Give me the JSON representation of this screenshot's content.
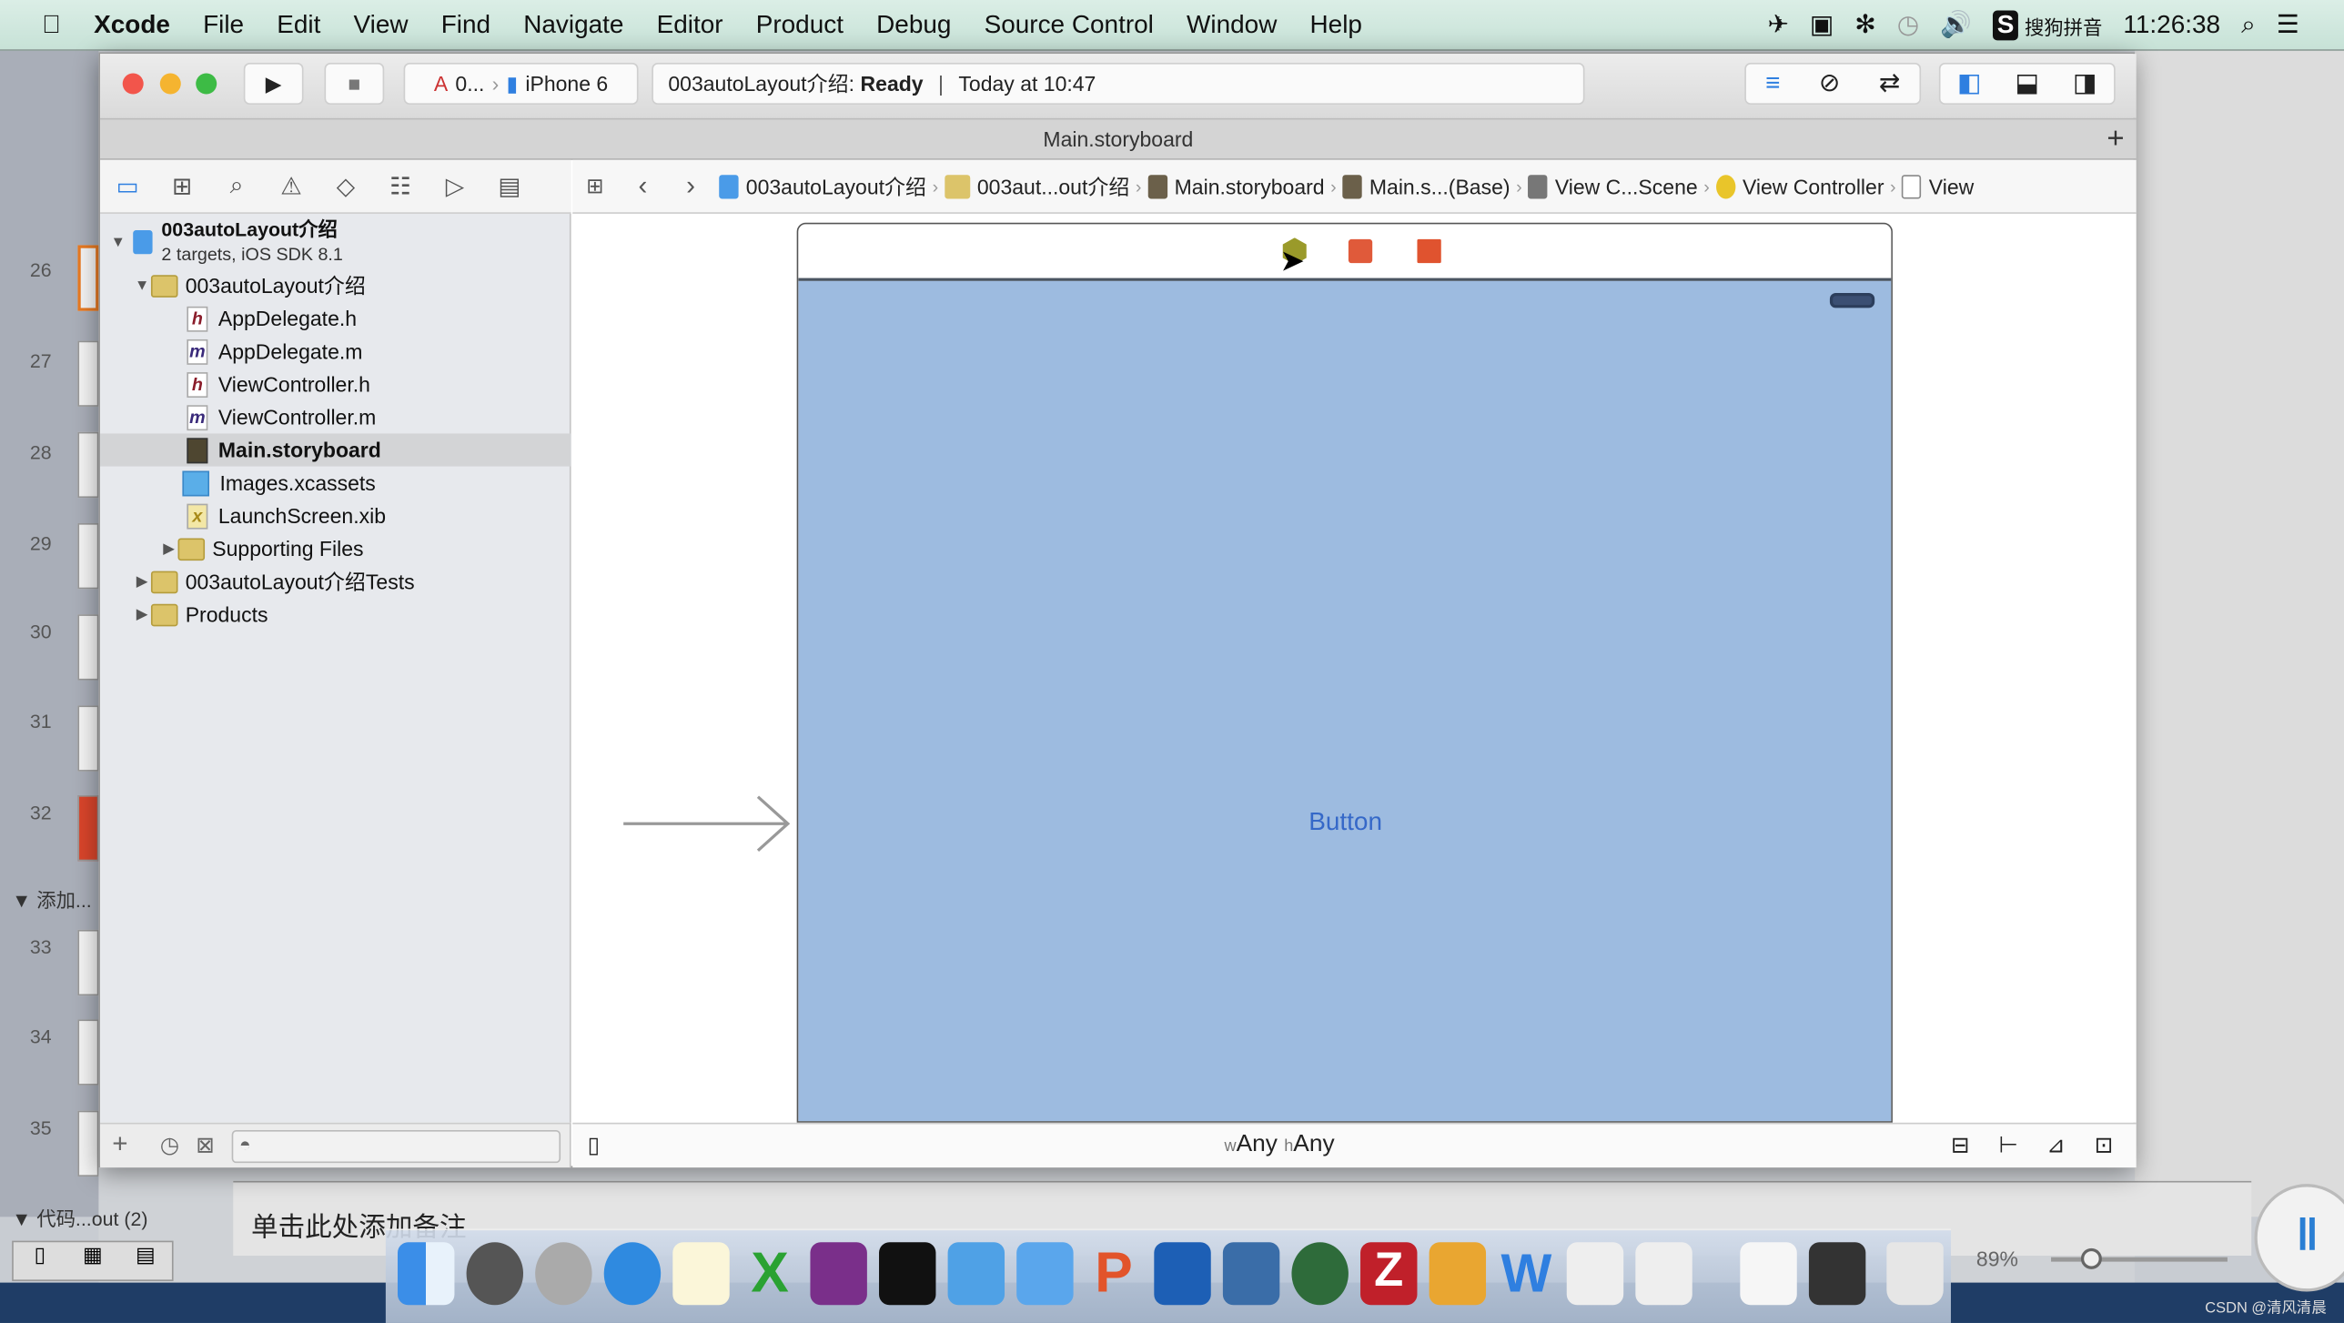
{
  "menubar": {
    "apple_icon": "apple-icon",
    "items": [
      "Xcode",
      "File",
      "Edit",
      "View",
      "Find",
      "Navigate",
      "Editor",
      "Product",
      "Debug",
      "Source Control",
      "Window",
      "Help"
    ],
    "input_method": "搜狗拼音",
    "clock": "11:26:38"
  },
  "toolbar": {
    "scheme": "0...",
    "device": "iPhone 6",
    "status_project": "003autoLayout介绍:",
    "status_state": "Ready",
    "status_time": "Today at 10:47"
  },
  "tab": {
    "title": "Main.storyboard"
  },
  "jumpbar": [
    "003autoLayout介绍",
    "003aut...out介绍",
    "Main.storyboard",
    "Main.s...(Base)",
    "View C...Scene",
    "View Controller",
    "View"
  ],
  "navigator": {
    "project_name": "003autoLayout介绍",
    "project_sub": "2 targets, iOS SDK 8.1",
    "items": [
      {
        "label": "003autoLayout介绍",
        "type": "folder"
      },
      {
        "label": "AppDelegate.h",
        "type": "h"
      },
      {
        "label": "AppDelegate.m",
        "type": "m"
      },
      {
        "label": "ViewController.h",
        "type": "h"
      },
      {
        "label": "ViewController.m",
        "type": "m"
      },
      {
        "label": "Main.storyboard",
        "type": "storyboard",
        "selected": true
      },
      {
        "label": "Images.xcassets",
        "type": "assets"
      },
      {
        "label": "LaunchScreen.xib",
        "type": "xib"
      },
      {
        "label": "Supporting Files",
        "type": "folder"
      },
      {
        "label": "003autoLayout介绍Tests",
        "type": "folder"
      },
      {
        "label": "Products",
        "type": "folder"
      }
    ]
  },
  "canvas": {
    "button_label": "Button",
    "size_w_prefix": "w",
    "size_w": "Any",
    "size_h_prefix": "h",
    "size_h": "Any",
    "scene_color": "#9dbbe0"
  },
  "keynote": {
    "slide_numbers": [
      "26",
      "27",
      "28",
      "29",
      "30",
      "31",
      "32",
      "33",
      "34",
      "35"
    ],
    "group_label": "▼ 添加...",
    "bottom_group": "▼ 代码...out (2)",
    "notes_placeholder": "单击此处添加备注",
    "zoom": "89%"
  },
  "watermark": "CSDN @清风清晨"
}
